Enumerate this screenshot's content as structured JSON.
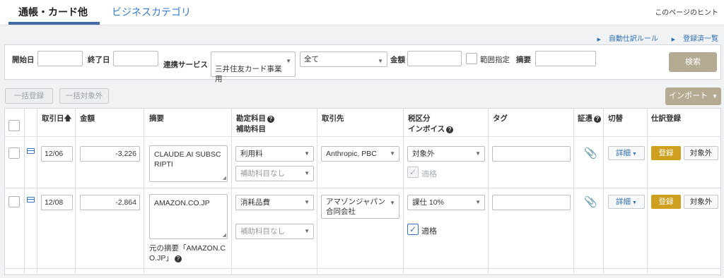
{
  "tabs": {
    "active": "通帳・カード他",
    "inactive": "ビジネスカテゴリ"
  },
  "hint": "このページのヒント",
  "toplinks": {
    "auto_rules": "自動仕訳ルール",
    "registered_list": "登録済一覧"
  },
  "filter": {
    "start_label": "開始日",
    "end_label": "終了日",
    "service_label": "連携サービス",
    "service_value": "三井住友カード事業\n用",
    "all_value": "全て",
    "amount_label": "金額",
    "range_label": "範囲指定",
    "memo_label": "摘要",
    "search_button": "検索"
  },
  "actions": {
    "bulk_register": "一括登録",
    "bulk_exclude": "一括対象外",
    "import": "インポート"
  },
  "table": {
    "headers": {
      "date": "取引日",
      "amount": "金額",
      "memo": "摘要",
      "account": "勘定科目",
      "sub_account": "補助科目",
      "partner": "取引先",
      "tax": "税区分",
      "invoice": "インボイス",
      "tag": "タグ",
      "evidence": "証憑",
      "toggle": "切替",
      "entry": "仕訳登録"
    },
    "rows": [
      {
        "date": "12/06",
        "amount": "-3,226",
        "memo": "CLAUDE.AI SUBSC\nRIPTI",
        "account": "利用料",
        "sub_account": "補助科目なし",
        "partner": "Anthropic, PBC",
        "tax": "対象外",
        "invoice_label": "適格",
        "invoice_checked": true,
        "invoice_disabled": true,
        "detail": "詳細",
        "register": "登録",
        "exclude": "対象外"
      },
      {
        "date": "12/08",
        "amount": "-2,864",
        "memo": "AMAZON.CO.JP",
        "original_memo": "元の摘要「AMAZON.C\nO.JP」",
        "account": "消耗品費",
        "sub_account": "補助科目なし",
        "partner": "アマゾンジャパン\n合同会社",
        "tax": "課仕 10%",
        "invoice_label": "適格",
        "invoice_checked": true,
        "invoice_disabled": false,
        "detail": "詳細",
        "register": "登録",
        "exclude": "対象外"
      }
    ]
  },
  "colors": {
    "accent": "#3f6aa7",
    "link": "#2d6db4",
    "gold": "#cfa020",
    "khaki": "#b5ab93"
  },
  "icons": {
    "card": "credit-card-icon",
    "clip": "paperclip-icon",
    "help": "question-circle-icon",
    "sort": "arrow-up-icon"
  }
}
